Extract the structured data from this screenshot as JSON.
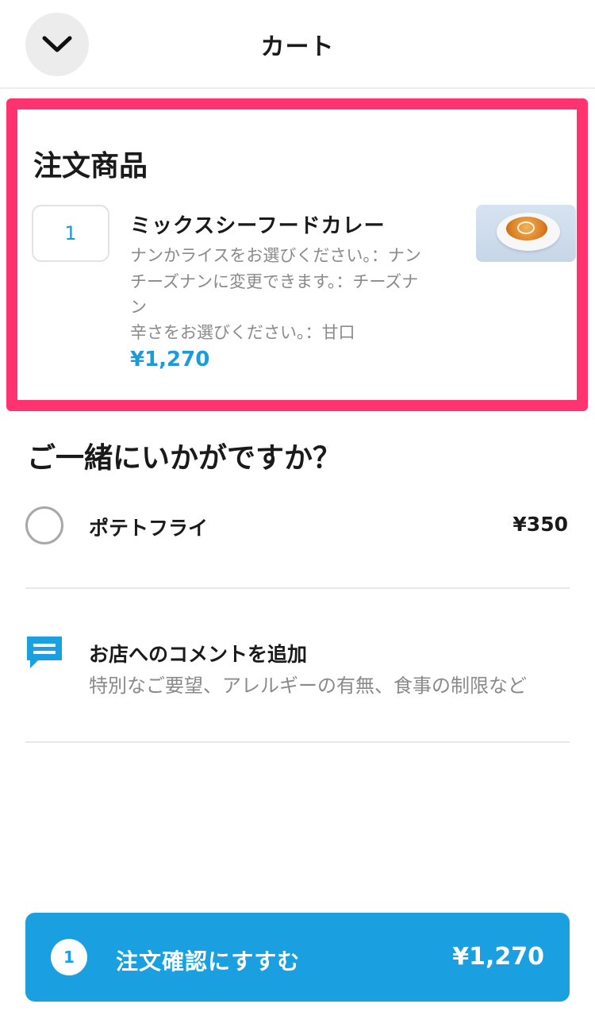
{
  "header": {
    "title": "カート",
    "back_icon": "chevron-down-icon"
  },
  "order": {
    "section_title": "注文商品",
    "item": {
      "quantity": "1",
      "name": "ミックスシーフードカレー",
      "options": [
        "ナンかライスをお選びください。：ナン",
        "チーズナンに変更できます。：チーズナ",
        "ン",
        "辛さをお選びください。：甘口"
      ],
      "price": "¥1,270"
    },
    "highlight_color": "#ff3370"
  },
  "suggest": {
    "section_title": "ご一緒にいかがですか？",
    "items": [
      {
        "name": "ポテトフライ",
        "price": "¥350"
      }
    ]
  },
  "comment": {
    "icon": "comment-icon",
    "title": "お店へのコメントを追加",
    "subtitle": "特別なご要望、アレルギーの有無、食事の制限など"
  },
  "checkout": {
    "count": "1",
    "label": "注文確認にすすむ",
    "total": "¥1,270",
    "color": "#1a9fe0"
  }
}
